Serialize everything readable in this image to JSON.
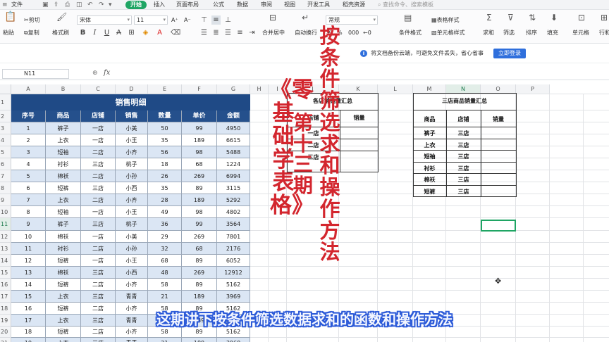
{
  "menubar": {
    "file_label": "文件",
    "tabs": [
      "开始",
      "插入",
      "页面布局",
      "公式",
      "数据",
      "审阅",
      "视图",
      "开发工具",
      "稻壳资源"
    ],
    "search_placeholder": "查找命令、搜索模板"
  },
  "ribbon": {
    "paste": "粘贴",
    "cut": "剪切",
    "copy": "复制",
    "format_painter": "格式刷",
    "font_name": "宋体",
    "font_size": "11",
    "number_format": "常规",
    "merge_center": "合并居中",
    "wrap_text": "自动换行",
    "table_style": "表格样式",
    "cond_format": "条件格式",
    "cell_style": "单元格样式",
    "sum": "求和",
    "filter": "筛选",
    "sort": "排序",
    "fill": "填充",
    "cells": "单元格",
    "row_col": "行和"
  },
  "notify": {
    "text": "将文档备份云端，可避免文件丢失，省心省事",
    "login_button": "立即登录"
  },
  "formulabar": {
    "name_box": "N11",
    "fx": "fx"
  },
  "grid": {
    "columns": [
      "A",
      "B",
      "C",
      "D",
      "E",
      "F",
      "G",
      "H",
      "I",
      "J",
      "K",
      "L",
      "M",
      "N",
      "O",
      "P"
    ],
    "rows": [
      "1",
      "2",
      "3",
      "4",
      "5",
      "6",
      "7",
      "8",
      "9",
      "10",
      "11",
      "12",
      "13",
      "14",
      "15",
      "16",
      "17",
      "18",
      "19",
      "20",
      "21"
    ],
    "selected_col": "N",
    "selected_row": "11"
  },
  "sales_table": {
    "title": "销售明细",
    "headers": [
      "序号",
      "商品",
      "店铺",
      "销售",
      "数量",
      "单价",
      "金额"
    ],
    "rows": [
      [
        "1",
        "裤子",
        "一店",
        "小美",
        "50",
        "99",
        "4950"
      ],
      [
        "2",
        "上衣",
        "一店",
        "小王",
        "35",
        "189",
        "6615"
      ],
      [
        "3",
        "短袖",
        "二店",
        "小齐",
        "56",
        "98",
        "5488"
      ],
      [
        "4",
        "衬衫",
        "三店",
        "桃子",
        "18",
        "68",
        "1224"
      ],
      [
        "5",
        "棉袄",
        "二店",
        "小孙",
        "26",
        "269",
        "6994"
      ],
      [
        "6",
        "短裤",
        "三店",
        "小西",
        "35",
        "89",
        "3115"
      ],
      [
        "7",
        "上衣",
        "二店",
        "小齐",
        "28",
        "189",
        "5292"
      ],
      [
        "8",
        "短袖",
        "一店",
        "小王",
        "49",
        "98",
        "4802"
      ],
      [
        "9",
        "裤子",
        "三店",
        "桃子",
        "36",
        "99",
        "3564"
      ],
      [
        "10",
        "棉袄",
        "一店",
        "小美",
        "29",
        "269",
        "7801"
      ],
      [
        "11",
        "衬衫",
        "二店",
        "小孙",
        "32",
        "68",
        "2176"
      ],
      [
        "12",
        "短裤",
        "一店",
        "小王",
        "68",
        "89",
        "6052"
      ],
      [
        "13",
        "棉袄",
        "三店",
        "小西",
        "48",
        "269",
        "12912"
      ],
      [
        "14",
        "短裤",
        "二店",
        "小齐",
        "58",
        "89",
        "5162"
      ],
      [
        "15",
        "上衣",
        "三店",
        "青青",
        "21",
        "189",
        "3969"
      ],
      [
        "16",
        "短裤",
        "二店",
        "小齐",
        "58",
        "89",
        "5162"
      ],
      [
        "17",
        "上衣",
        "三店",
        "青青",
        "21",
        "189",
        "3969"
      ],
      [
        "18",
        "短裤",
        "二店",
        "小齐",
        "58",
        "89",
        "5162"
      ],
      [
        "19",
        "上衣",
        "三店",
        "青青",
        "21",
        "189",
        "3969"
      ]
    ]
  },
  "store_summary": {
    "title": "各店铺销量汇总",
    "headers": [
      "店铺",
      "销量"
    ],
    "rows": [
      [
        "一店",
        ""
      ],
      [
        "二店",
        ""
      ],
      [
        "三店",
        ""
      ]
    ]
  },
  "store3_summary": {
    "title": "三店商品销量汇总",
    "headers": [
      "商品",
      "店铺",
      "销量"
    ],
    "rows": [
      [
        "裤子",
        "三店",
        ""
      ],
      [
        "上衣",
        "三店",
        ""
      ],
      [
        "短袖",
        "三店",
        ""
      ],
      [
        "衬衫",
        "三店",
        ""
      ],
      [
        "棉袄",
        "三店",
        ""
      ],
      [
        "短裤",
        "三店",
        ""
      ]
    ]
  },
  "overlay": {
    "series_title": "《零基础学表格》",
    "episode": "第十三期",
    "topic": "按条件筛选求和操作方法",
    "subtitle": "这期讲下按条件筛选数据求和的函数和操作方法"
  },
  "colors": {
    "title_bg": "#1f4a86",
    "header_bg": "#25508c",
    "row_tint": "#dbe6f4",
    "accent_green": "#1fa564",
    "overlay_red": "#d3262e",
    "subtitle_outline": "#2d5bd8"
  }
}
